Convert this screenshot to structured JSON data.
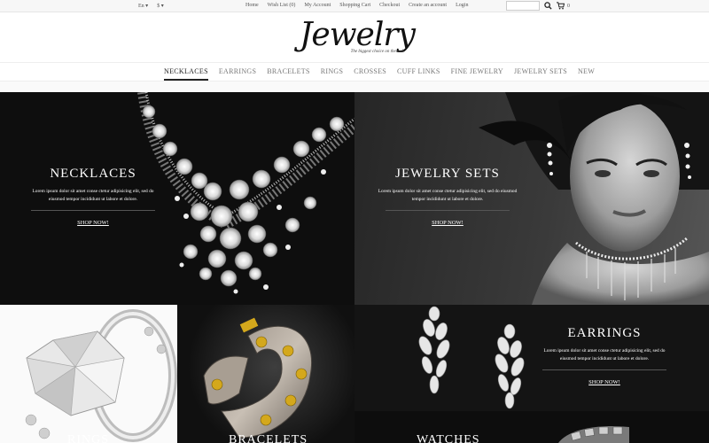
{
  "topbar": {
    "language": "En",
    "currency": "$",
    "links": [
      "Home",
      "Wish List  (0)",
      "My Account",
      "Shopping Cart",
      "Checkout",
      "Create an account",
      "Login"
    ],
    "cart_count": "0"
  },
  "header": {
    "logo": "Jewelry",
    "tagline": "The biggest choice on the web"
  },
  "nav": {
    "items": [
      "NECKLACES",
      "EARRINGS",
      "BRACELETS",
      "RINGS",
      "CROSSES",
      "CUFF LINKS",
      "FINE JEWELRY",
      "JEWELRY SETS",
      "NEW"
    ],
    "active": "NECKLACES"
  },
  "banners": {
    "necklaces": {
      "title": "NECKLACES",
      "desc": "Lorem ipsum dolor sit amet conse ctetur adipisicing elit, sed do eiusmod tempor incididunt ut labore et dolore.",
      "cta": "SHOP NOW!"
    },
    "jewelry_sets": {
      "title": "JEWELRY SETS",
      "desc": "Lorem ipsum dolor sit amet conse ctetur adipisicing elit, sed do eiusmod tempor incididunt ut labore et dolore.",
      "cta": "SHOP NOW!"
    },
    "earrings": {
      "title": "EARRINGS",
      "desc": "Lorem ipsum dolor sit amet conse ctetur adipisicing elit, sed do eiusmod tempor incididunt ut labore et dolore.",
      "cta": "SHOP NOW!"
    },
    "rings": {
      "title": "RINGS"
    },
    "bracelets": {
      "title": "BRACELETS"
    },
    "watches": {
      "title": "WATCHES"
    }
  },
  "icons": {
    "search": "search-icon",
    "cart": "cart-icon"
  }
}
